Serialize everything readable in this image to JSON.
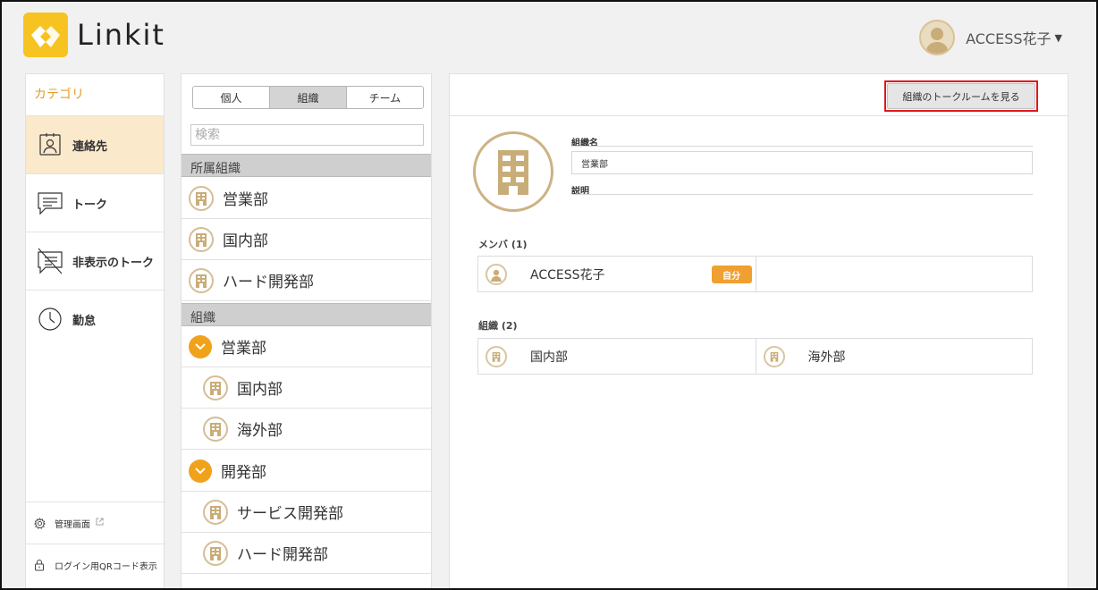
{
  "header": {
    "logo_text": "Linkit",
    "user_name": "ACCESS花子"
  },
  "sidebar": {
    "heading": "カテゴリ",
    "items": [
      {
        "label": "連絡先",
        "icon": "contact-card-icon",
        "active": true
      },
      {
        "label": "トーク",
        "icon": "chat-bubble-icon"
      },
      {
        "label": "非表示のトーク",
        "icon": "hidden-chat-icon"
      },
      {
        "label": "勤怠",
        "icon": "clock-icon"
      }
    ],
    "admin_label": "管理画面",
    "qr_label": "ログイン用QRコード表示"
  },
  "list": {
    "tabs": [
      "個人",
      "組織",
      "チーム"
    ],
    "active_tab": "組織",
    "search_placeholder": "検索",
    "affiliated_header": "所属組織",
    "affiliated": [
      "営業部",
      "国内部",
      "ハード開発部"
    ],
    "org_header": "組織",
    "tree": [
      {
        "label": "営業部",
        "type": "group"
      },
      {
        "label": "国内部",
        "type": "child"
      },
      {
        "label": "海外部",
        "type": "child"
      },
      {
        "label": "開発部",
        "type": "group"
      },
      {
        "label": "サービス開発部",
        "type": "child"
      },
      {
        "label": "ハード開発部",
        "type": "child"
      }
    ]
  },
  "detail": {
    "talk_button": "組織のトークルームを見る",
    "name_label": "組織名",
    "name_value": "営業部",
    "desc_label": "説明",
    "members_header": "メンバ (1)",
    "members": [
      {
        "name": "ACCESS花子",
        "badge": "自分"
      }
    ],
    "orgs_header": "組織 (2)",
    "orgs": [
      "国内部",
      "海外部"
    ]
  },
  "colors": {
    "accent": "#f0a21a",
    "active_bg": "#fbe9cc",
    "highlight": "#e0161b",
    "logo": "#f6c320"
  }
}
